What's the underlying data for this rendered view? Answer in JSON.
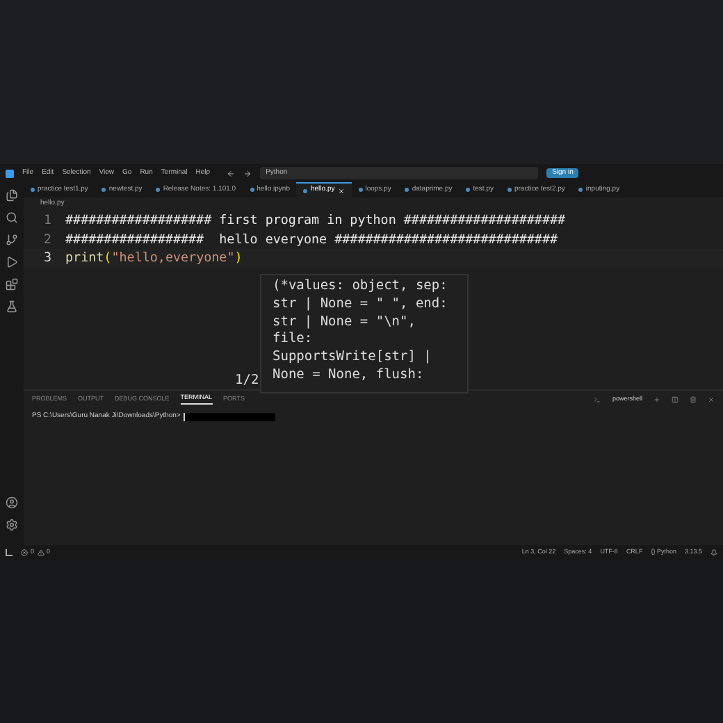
{
  "menu": [
    "File",
    "Edit",
    "Selection",
    "View",
    "Go",
    "Run",
    "Terminal",
    "Help"
  ],
  "search": {
    "value": "Python"
  },
  "sign_in": "Sign in",
  "tabs": [
    {
      "label": "practice test1.py",
      "selected": false
    },
    {
      "label": "newtest.py",
      "selected": false
    },
    {
      "label": "Release Notes: 1.101.0",
      "selected": false
    },
    {
      "label": "hello.ipynb",
      "selected": false
    },
    {
      "label": "hello.py",
      "selected": true
    },
    {
      "label": "loops.py",
      "selected": false
    },
    {
      "label": "dataprime.py",
      "selected": false
    },
    {
      "label": "test.py",
      "selected": false
    },
    {
      "label": "practice test2.py",
      "selected": false
    },
    {
      "label": "inputing.py",
      "selected": false
    }
  ],
  "breadcrumb": "hello.py",
  "code_lines": [
    {
      "number": "1",
      "text": "################### first program in python #####################",
      "kind": "comment"
    },
    {
      "number": "2",
      "text": "##################  hello everyone #############################",
      "kind": "comment"
    },
    {
      "number": "3",
      "kind": "call",
      "function": "print",
      "open": "(",
      "close": ")",
      "argument": "\"hello,everyone\""
    }
  ],
  "hover": {
    "lines": [
      "(*values: object, sep:",
      "str | None = \" \", end:",
      "str | None = \"\\n\",",
      "file:",
      "SupportsWrite[str] |",
      "None = None, flush:"
    ],
    "counter": "1/2"
  },
  "panel_tabs": [
    {
      "label": "PROBLEMS",
      "selected": false
    },
    {
      "label": "OUTPUT",
      "selected": false
    },
    {
      "label": "DEBUG CONSOLE",
      "selected": false
    },
    {
      "label": "TERMINAL",
      "selected": true
    },
    {
      "label": "PORTS",
      "selected": false
    }
  ],
  "terminal_name": "powershell",
  "terminal_prompt": "PS C:\\Users\\Guru Nanak Ji\\Downloads\\Python>",
  "status": {
    "errors": "0",
    "warnings": "0",
    "items": [
      "Ln 3, Col 22",
      "Spaces: 4",
      "UTF-8",
      "CRLF",
      "{} Python",
      "3.13.5"
    ]
  }
}
